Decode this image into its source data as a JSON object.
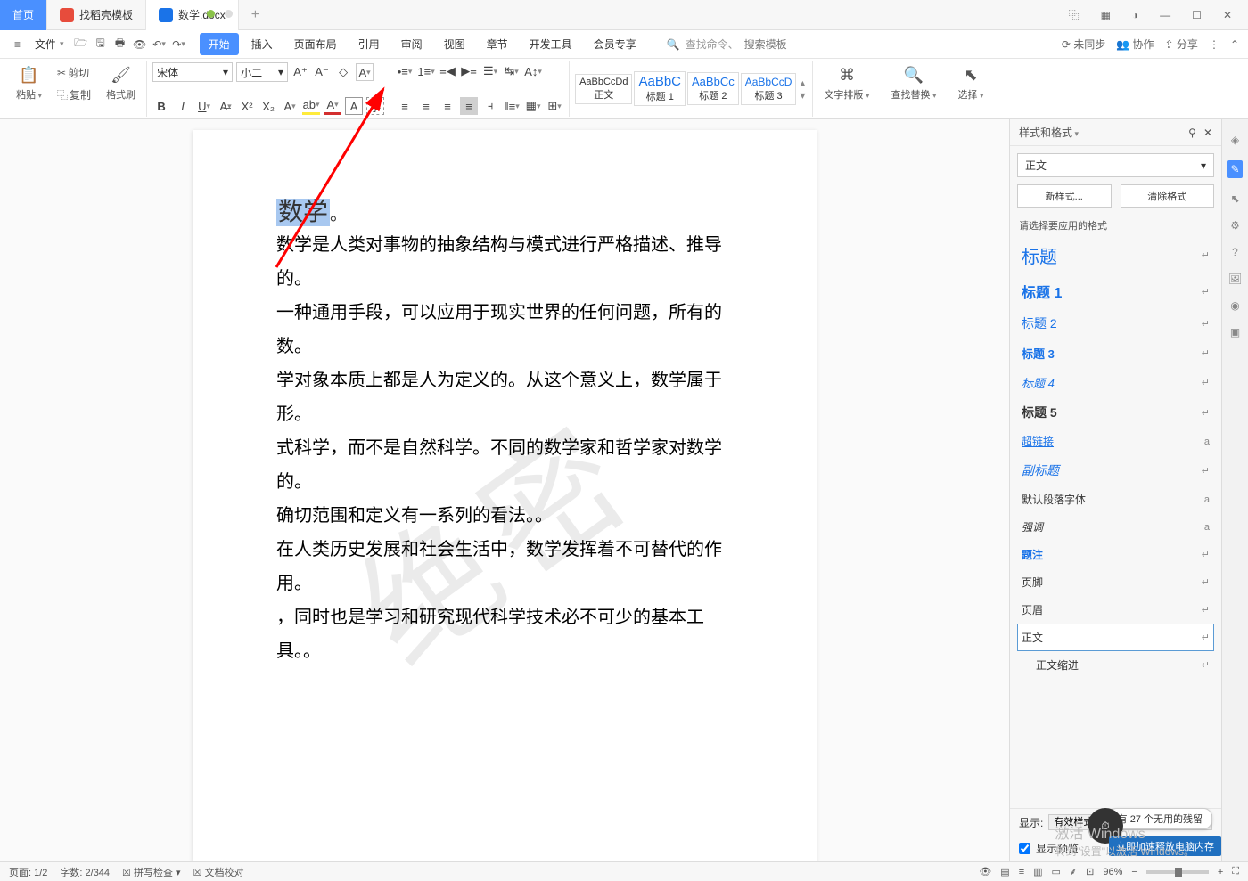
{
  "titlebar": {
    "home": "首页",
    "tab_template": "找稻壳模板",
    "tab_doc": "数学.docx",
    "plus": "+"
  },
  "window_icons": {
    "layout": "⿻",
    "grid": "▦",
    "min": "—",
    "max": "☐",
    "close": "✕"
  },
  "menubar": {
    "file": "文件",
    "tabs": [
      "开始",
      "插入",
      "页面布局",
      "引用",
      "审阅",
      "视图",
      "章节",
      "开发工具",
      "会员专享"
    ],
    "search_prefix": "查找命令、",
    "search_placeholder": "搜索模板",
    "unsync": "未同步",
    "coop": "协作",
    "share": "分享"
  },
  "ribbon": {
    "paste": "粘贴",
    "cut": "剪切",
    "copy": "复制",
    "format": "格式刷",
    "font": "宋体",
    "size": "小二",
    "styles": [
      {
        "preview": "AaBbCcDd",
        "label": "正文"
      },
      {
        "preview": "AaBbC",
        "label": "标题 1"
      },
      {
        "preview": "AaBbCc",
        "label": "标题 2"
      },
      {
        "preview": "AaBbCcD",
        "label": "标题 3"
      }
    ],
    "text_layout": "文字排版",
    "find_replace": "查找替换",
    "select": "选择"
  },
  "document": {
    "title": "数学",
    "body": "数学是人类对事物的抽象结构与模式进行严格描述、推导的。\n一种通用手段，可以应用于现实世界的任何问题，所有的数。\n学对象本质上都是人为定义的。从这个意义上，数学属于形。\n式科学，而不是自然科学。不同的数学家和哲学家对数学的。\n确切范围和定义有一系列的看法。。\n在人类历史发展和社会生活中，数学发挥着不可替代的作用。\n，同时也是学习和研究现代科学技术必不可少的基本工具。。",
    "watermark": "绝密"
  },
  "sidepanel": {
    "title": "样式和格式",
    "current": "正文",
    "new_style": "新样式...",
    "clear": "清除格式",
    "hint": "请选择要应用的格式",
    "list": [
      {
        "t": "标题",
        "css": "color:#1a73e8;font-size:20px"
      },
      {
        "t": "标题 1",
        "css": "color:#1a73e8;font-size:16px;font-weight:bold"
      },
      {
        "t": "标题 2",
        "css": "color:#1a73e8;font-size:14px"
      },
      {
        "t": "标题 3",
        "css": "color:#1a73e8;font-size:13px;font-weight:bold"
      },
      {
        "t": "标题 4",
        "css": "color:#1a73e8;font-style:italic;font-size:13px"
      },
      {
        "t": "标题 5",
        "css": "font-weight:bold;font-size:14px"
      },
      {
        "t": "超链接",
        "css": "color:#1a73e8;text-decoration:underline;font-size:12px",
        "r": "a"
      },
      {
        "t": "副标题",
        "css": "color:#1a73e8;font-style:italic;font-size:14px"
      },
      {
        "t": "默认段落字体",
        "css": "font-size:12px",
        "r": "a"
      },
      {
        "t": "强调",
        "css": "font-style:italic;font-size:12px",
        "r": "a"
      },
      {
        "t": "题注",
        "css": "color:#1a73e8;font-size:12px;font-weight:bold"
      },
      {
        "t": "页脚",
        "css": "font-size:12px"
      },
      {
        "t": "页眉",
        "css": "font-size:12px"
      },
      {
        "t": "正文",
        "css": "font-size:12px",
        "sel": true
      },
      {
        "t": "正文缩进",
        "css": "font-size:12px;padding-left:16px"
      }
    ],
    "show": "显示:",
    "show_val": "有效样式",
    "preview": "显示预览",
    "residue": "有 27 个无用的残留"
  },
  "statusbar": {
    "page": "页面: 1/2",
    "words": "字数: 2/344",
    "spellcheck": "拼写检查",
    "proof": "文档校对",
    "zoom": "96%"
  },
  "activate": {
    "l1": "激活 Windows",
    "l2": "转到\"设置\"以激活 Windows。"
  },
  "bhint": "立即加速释放电脑内存"
}
